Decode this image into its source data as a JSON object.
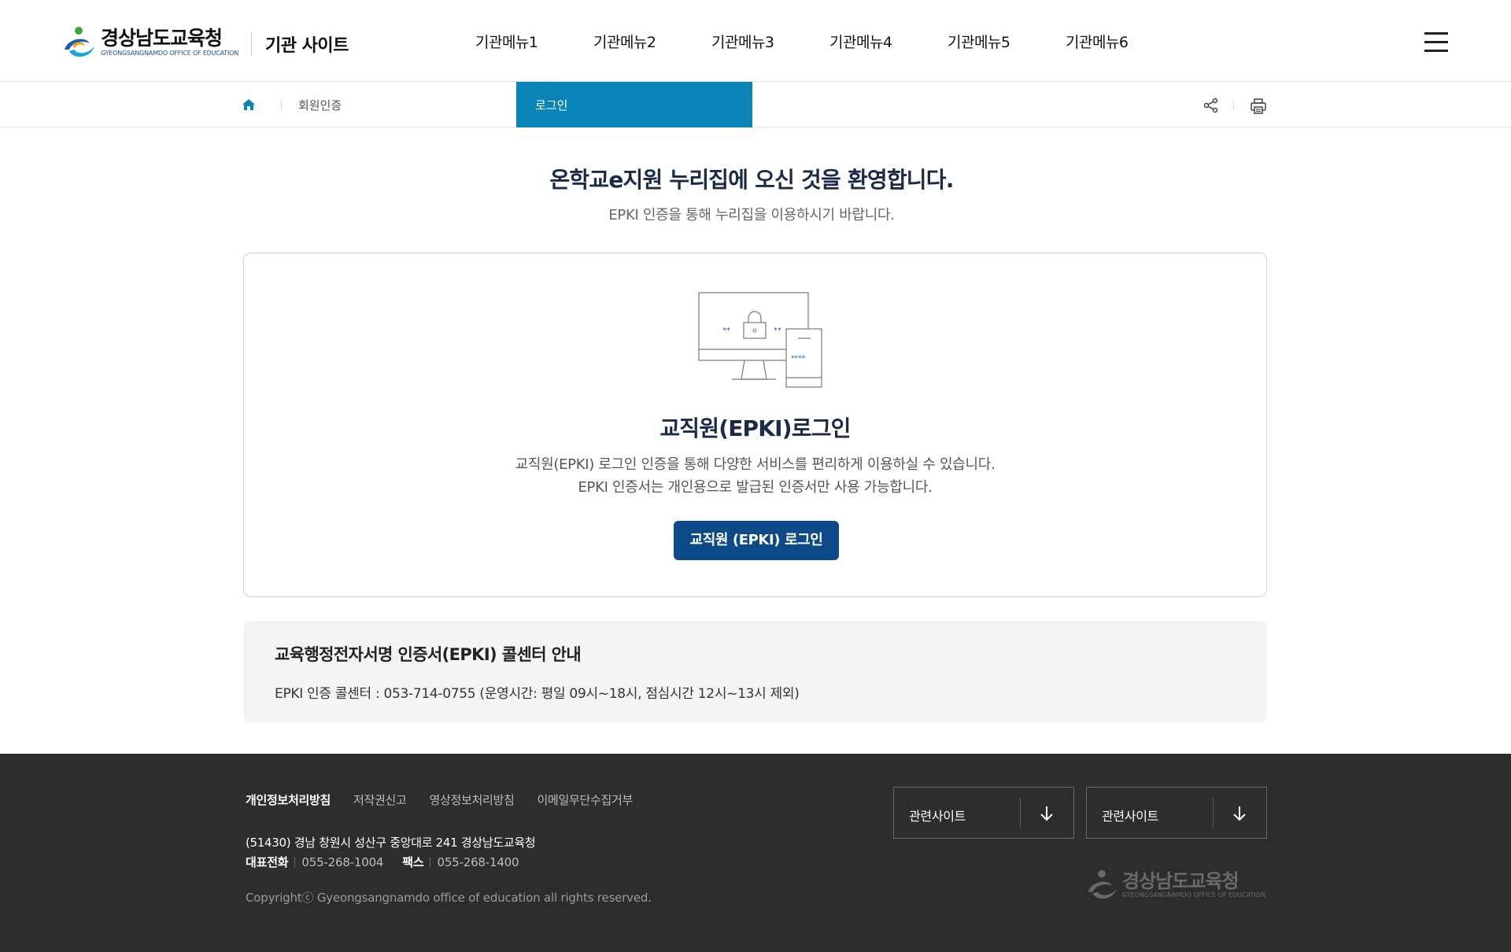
{
  "header": {
    "logo_ko": "경상남도교육청",
    "logo_en": "GYEONGSANGNAMDO OFFICE OF EDUCATION",
    "site_name": "기관 사이트",
    "menu": [
      "기관메뉴1",
      "기관메뉴2",
      "기관메뉴3",
      "기관메뉴4",
      "기관메뉴5",
      "기관메뉴6"
    ],
    "menu_icon": "hamburger-icon"
  },
  "subnav": {
    "home_icon": "home-icon",
    "category": "회원인증",
    "active": "로그인",
    "share_icon": "share-icon",
    "print_icon": "print-icon",
    "active_color": "#0a84b6"
  },
  "welcome": {
    "title": "온학교e지원 누리집에 오신 것을 환영합니다.",
    "subtitle": "EPKI 인증을 통해 누리집을 이용하시기 바랍니다."
  },
  "login_card": {
    "illustration": "computer-lock-icon",
    "title": "교직원(EPKI)로그인",
    "desc_line1": "교직원(EPKI) 로그인 인증을 통해 다양한 서비스를 편리하게 이용하실 수 있습니다.",
    "desc_line2": "EPKI 인증서는 개인용으로 발급된 인증서만 사용 가능합니다.",
    "button_label": "교직원 (EPKI) 로그인",
    "button_color": "#0c4a8a"
  },
  "info": {
    "title": "교육행정전자서명 인증서(EPKI) 콜센터 안내",
    "text": "EPKI 인증 콜센터 : 053-714-0755 (운영시간: 평일 09시~18시, 점심시간 12시~13시 제외)"
  },
  "footer": {
    "links": [
      "개인정보처리방침",
      "저작권신고",
      "영상정보처리방침",
      "이메일무단수집거부"
    ],
    "address": "(51430) 경남 창원시 성산구 중앙대로 241 경상남도교육청",
    "tel_label": "대표전화",
    "tel": "055-268-1004",
    "fax_label": "팩스",
    "fax": "055-268-1400",
    "copyright": "Copyrightⓒ Gyeongsangnamdo office of education all rights reserved.",
    "related_1": "관련사이트",
    "related_2": "관련사이트",
    "logo_ko": "경상남도교육청",
    "logo_en": "GYEONGSANGNAMDO OFFICE OF EDUCATION",
    "background": "#2d2d2d"
  }
}
